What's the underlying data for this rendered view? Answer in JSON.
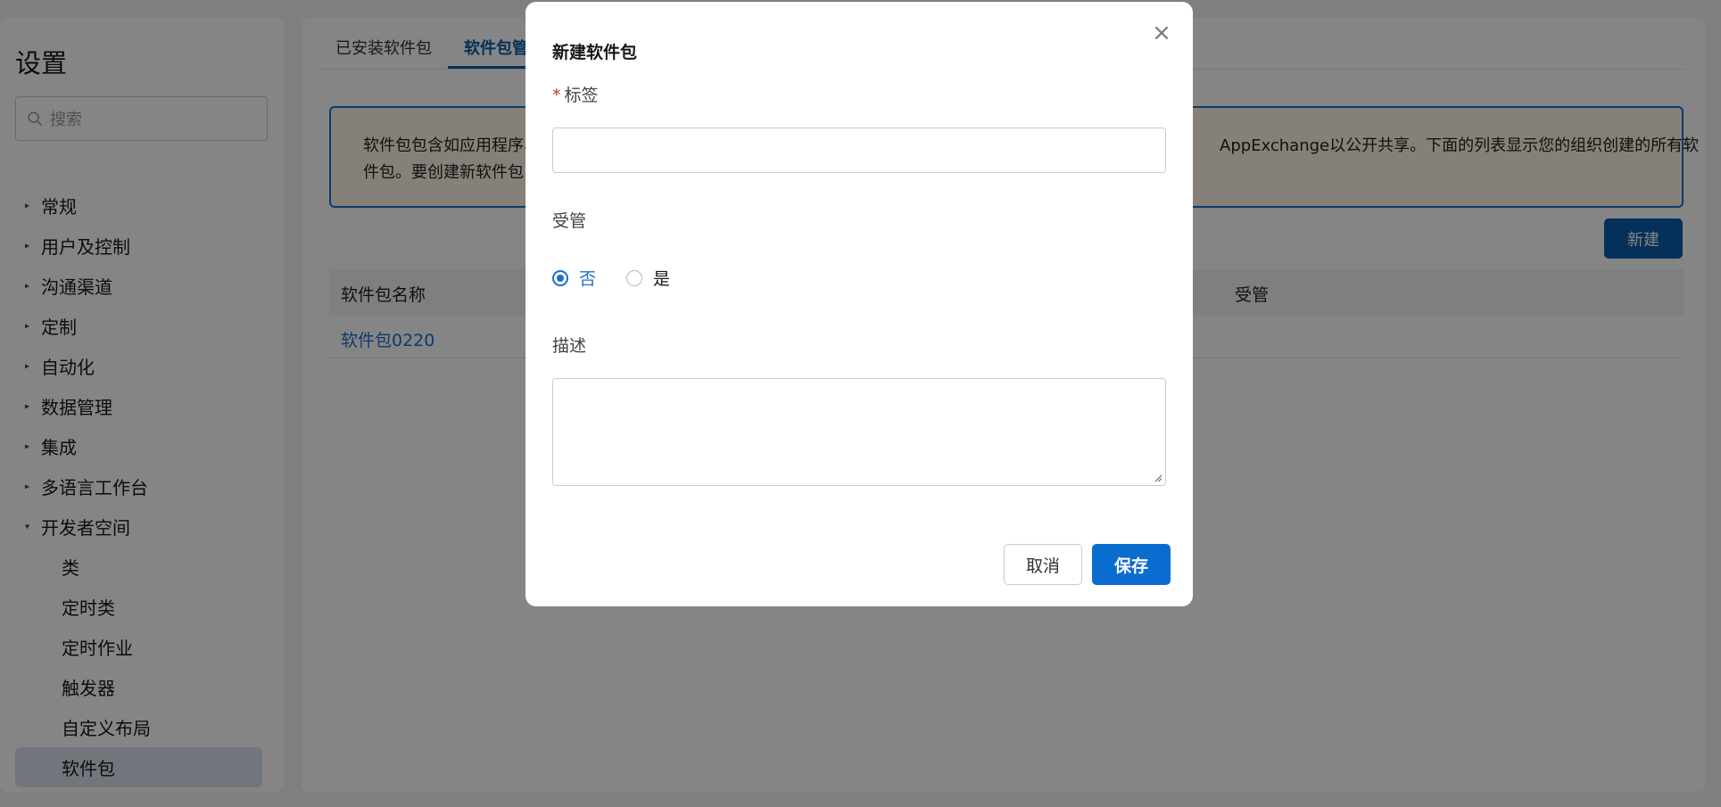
{
  "sidebar": {
    "title": "设置",
    "search_placeholder": "搜索",
    "items": [
      {
        "label": "常规",
        "caret": "▸"
      },
      {
        "label": "用户及控制",
        "caret": "▸"
      },
      {
        "label": "沟通渠道",
        "caret": "▸"
      },
      {
        "label": "定制",
        "caret": "▸"
      },
      {
        "label": "自动化",
        "caret": "▸"
      },
      {
        "label": "数据管理",
        "caret": "▸"
      },
      {
        "label": "集成",
        "caret": "▸"
      },
      {
        "label": "多语言工作台",
        "caret": "▸"
      },
      {
        "label": "开发者空间",
        "caret": "▾"
      }
    ],
    "sub_items": [
      {
        "label": "类"
      },
      {
        "label": "定时类"
      },
      {
        "label": "定时作业"
      },
      {
        "label": "触发器"
      },
      {
        "label": "自定义布局"
      },
      {
        "label": "软件包"
      }
    ]
  },
  "main": {
    "tabs": [
      {
        "label": "已安装软件包"
      },
      {
        "label": "软件包管"
      }
    ],
    "info": {
      "left_line1": "软件包包含如应用程序、",
      "left_line2": "件包。要创建新软件包，",
      "right_line1": "AppExchange以公开共享。下面的列表显示您的组织创建的所有软"
    },
    "new_button": "新建",
    "table": {
      "headers": [
        "软件包名称",
        "受管"
      ],
      "rows": [
        {
          "name": "软件包0220"
        }
      ]
    }
  },
  "modal": {
    "title": "新建软件包",
    "close": "×",
    "label_field": {
      "required_mark": "*",
      "label": "标签",
      "value": ""
    },
    "managed_label": "受管",
    "radio_no": "否",
    "radio_yes": "是",
    "desc_label": "描述",
    "desc_value": "",
    "cancel": "取消",
    "save": "保存"
  },
  "colors": {
    "accent": "#0b6ccf",
    "link": "#1b6fcf"
  }
}
